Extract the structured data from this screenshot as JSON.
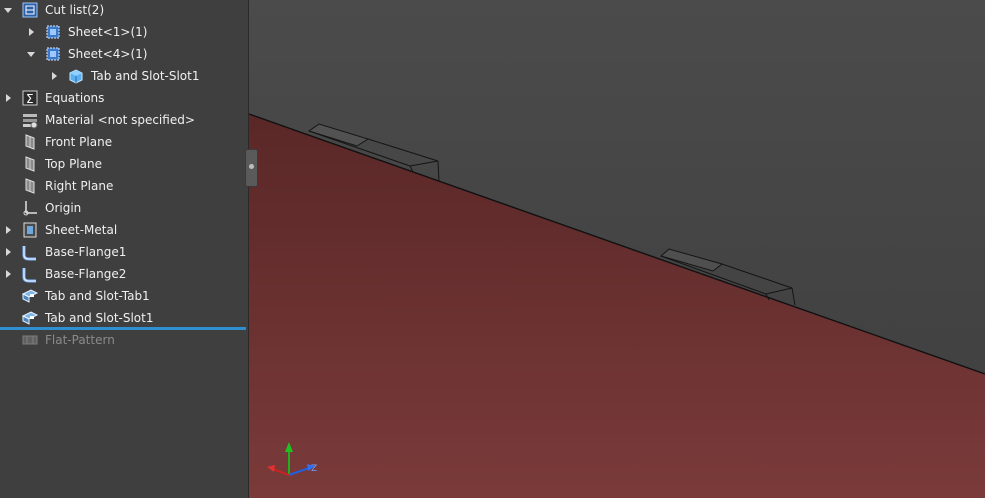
{
  "tree": {
    "items": [
      {
        "label": "Cut list(2)",
        "icon": "cut-list-icon",
        "indent": 0,
        "expand": "expanded",
        "state": "normal"
      },
      {
        "label": "Sheet<1>(1)",
        "icon": "sheet-body-folder-icon",
        "indent": 1,
        "expand": "collapsed",
        "state": "normal"
      },
      {
        "label": "Sheet<4>(1)",
        "icon": "sheet-body-folder-icon",
        "indent": 1,
        "expand": "expanded",
        "state": "normal"
      },
      {
        "label": "Tab and Slot-Slot1",
        "icon": "solid-body-icon",
        "indent": 2,
        "expand": "collapsed",
        "state": "normal"
      },
      {
        "label": "Equations",
        "icon": "equations-icon",
        "indent": 0,
        "expand": "collapsed",
        "state": "normal"
      },
      {
        "label": "Material <not specified>",
        "icon": "material-icon",
        "indent": 0,
        "expand": "none",
        "state": "normal"
      },
      {
        "label": "Front Plane",
        "icon": "plane-icon",
        "indent": 0,
        "expand": "none",
        "state": "normal"
      },
      {
        "label": "Top Plane",
        "icon": "plane-icon",
        "indent": 0,
        "expand": "none",
        "state": "normal"
      },
      {
        "label": "Right Plane",
        "icon": "plane-icon",
        "indent": 0,
        "expand": "none",
        "state": "normal"
      },
      {
        "label": "Origin",
        "icon": "origin-icon",
        "indent": 0,
        "expand": "none",
        "state": "normal"
      },
      {
        "label": "Sheet-Metal",
        "icon": "sheet-metal-icon",
        "indent": 0,
        "expand": "collapsed",
        "state": "normal"
      },
      {
        "label": "Base-Flange1",
        "icon": "base-flange-icon",
        "indent": 0,
        "expand": "collapsed",
        "state": "normal"
      },
      {
        "label": "Base-Flange2",
        "icon": "base-flange-icon",
        "indent": 0,
        "expand": "collapsed",
        "state": "normal"
      },
      {
        "label": "Tab and Slot-Tab1",
        "icon": "tab-and-slot-icon",
        "indent": 0,
        "expand": "none",
        "state": "normal"
      },
      {
        "label": "Tab and Slot-Slot1",
        "icon": "tab-and-slot-icon",
        "indent": 0,
        "expand": "none",
        "state": "normal"
      },
      {
        "label": "Flat-Pattern",
        "icon": "flat-pattern-icon",
        "indent": 0,
        "expand": "none",
        "state": "suppressed"
      }
    ]
  },
  "viewport": {
    "triad": {
      "z_label": "Z"
    },
    "colors": {
      "part": "#6b2f2f",
      "background": "#484848",
      "edge": "#111111",
      "triad_x": "#d02020",
      "triad_y": "#20b020",
      "triad_z": "#2060e0"
    }
  },
  "colors": {
    "panel": "#3f3f3f",
    "rollback_bar": "#2f8fd1",
    "text": "#f0f0f0",
    "text_suppressed": "#8a8a8a"
  }
}
